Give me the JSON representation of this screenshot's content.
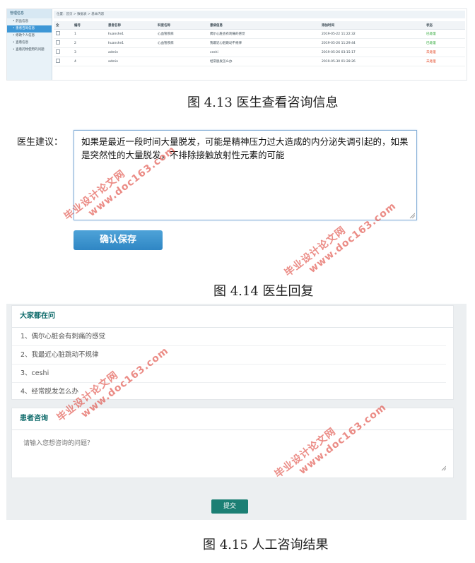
{
  "fig_4_13": {
    "sidebar": {
      "header": "管理信息",
      "items": [
        "药品信息",
        "患者咨询信息",
        "修改个人信息",
        "查看信息",
        "查看药物使用的问题"
      ],
      "active_index": 1
    },
    "breadcrumb": "位置：首页 > 数据表 > 基本内容",
    "table": {
      "columns": [
        "",
        "编号",
        "患者名称",
        "科室名称",
        "患病信息",
        "添加时间",
        "状态"
      ],
      "rows": [
        {
          "id": "1",
          "patient": "huanshe1",
          "dept": "心血管疾病",
          "info": "偶尔心脏会有刺痛的感觉",
          "time": "2019-05-22 11:22:32",
          "status": "已处理",
          "status_ok": true
        },
        {
          "id": "2",
          "patient": "huanshe1",
          "dept": "心血管疾病",
          "info": "我最近心脏跳动不规律",
          "time": "2019-05-26 11:29:44",
          "status": "已处理",
          "status_ok": true
        },
        {
          "id": "3",
          "patient": "admin",
          "dept": "",
          "info": "ceshi",
          "time": "2019-05-26 03:15:17",
          "status": "未处理",
          "status_ok": false
        },
        {
          "id": "4",
          "patient": "admin",
          "dept": "",
          "info": "经常脱发怎么办",
          "time": "2019-05-30 01:28:26",
          "status": "未处理",
          "status_ok": false
        }
      ]
    },
    "caption": "图 4.13 医生查看咨询信息"
  },
  "fig_4_14": {
    "label": "医生建议：",
    "advice_text": "如果是最近一段时间大量脱发，可能是精神压力过大造成的内分泌失调引起的，如果是突然性的大量脱发，不排除接触放射性元素的可能",
    "save_button": "确认保存",
    "caption": "图 4.14  医生回复"
  },
  "fig_4_15": {
    "faq_title": "大家都在问",
    "faq_items": [
      "1、偶尔心脏会有刺痛的感觉",
      "2、我最近心脏跳动不规律",
      "3、ceshi",
      "4、经常脱发怎么办"
    ],
    "consult_title": "患者咨询",
    "consult_placeholder": "请输入您想咨询的问题？",
    "submit_button": "提交",
    "caption": "图 4.15 人工咨询结果"
  },
  "watermark": {
    "line1": "毕业设计论文网",
    "line2": "www.doc163.com"
  },
  "colors": {
    "accent_blue": "#3d97d6",
    "teal": "#0f6b6b",
    "status_done": "#21a32b",
    "status_pending": "#e2421f",
    "watermark": "#de463c"
  }
}
